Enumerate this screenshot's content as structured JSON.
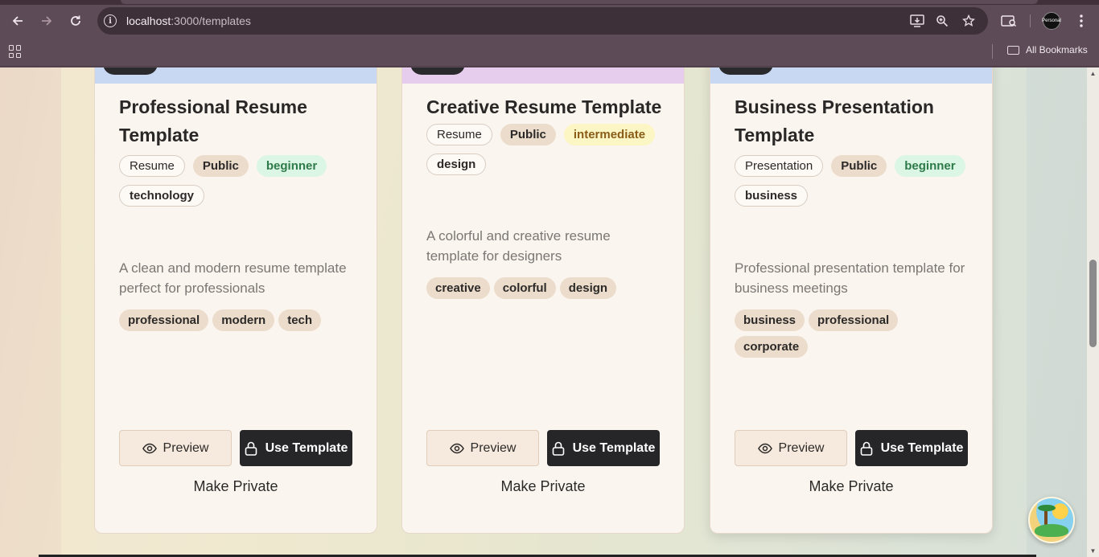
{
  "browser": {
    "url_host": "localhost",
    "url_path": ":3000/templates",
    "bookmarks_label": "All Bookmarks",
    "profile_initials": "Personal"
  },
  "cards": [
    {
      "title": "Professional Resume Template",
      "badges": [
        {
          "text": "Resume",
          "style": "outline"
        },
        {
          "text": "Public",
          "style": "beige"
        },
        {
          "text": "beginner",
          "style": "green"
        },
        {
          "text": "technology",
          "style": "outline"
        }
      ],
      "description": "A clean and modern resume template perfect for professionals",
      "tags": [
        "professional",
        "modern",
        "tech"
      ],
      "header_color": "#c8d8f2",
      "preview_label": "Preview",
      "use_label": "Use Template",
      "make_private_label": "Make Private"
    },
    {
      "title": "Creative Resume Template",
      "badges": [
        {
          "text": "Resume",
          "style": "outline"
        },
        {
          "text": "Public",
          "style": "beige"
        },
        {
          "text": "intermediate",
          "style": "yellow"
        },
        {
          "text": "design",
          "style": "outline"
        }
      ],
      "description": "A colorful and creative resume template for designers",
      "tags": [
        "creative",
        "colorful",
        "design"
      ],
      "header_color": "#e6cdee",
      "preview_label": "Preview",
      "use_label": "Use Template",
      "make_private_label": "Make Private"
    },
    {
      "title": "Business Presentation Template",
      "badges": [
        {
          "text": "Presentation",
          "style": "outline"
        },
        {
          "text": "Public",
          "style": "beige"
        },
        {
          "text": "beginner",
          "style": "green"
        },
        {
          "text": "business",
          "style": "outline"
        }
      ],
      "description": "Professional presentation template for business meetings",
      "tags": [
        "business",
        "professional",
        "corporate"
      ],
      "header_color": "#c8d8f2",
      "preview_label": "Preview",
      "use_label": "Use Template",
      "make_private_label": "Make Private"
    }
  ]
}
